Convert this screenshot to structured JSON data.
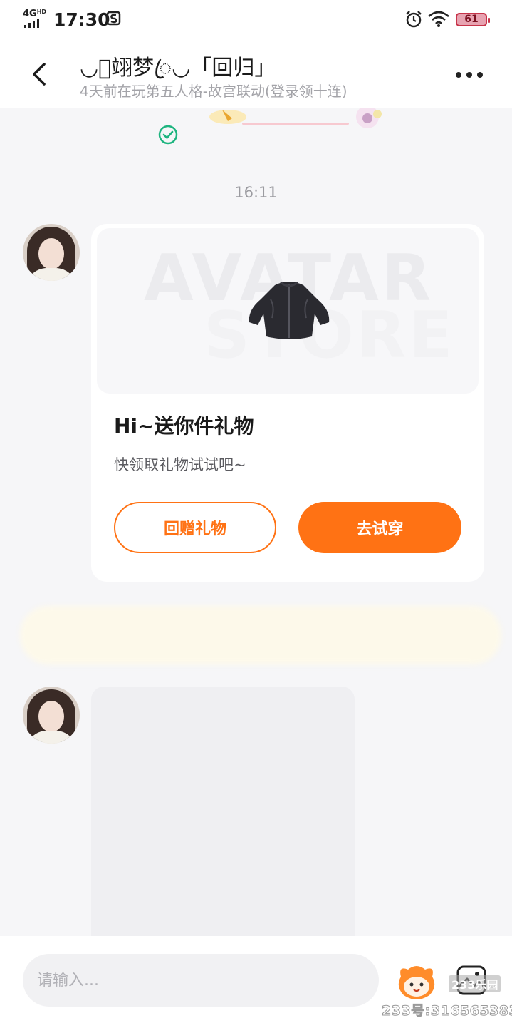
{
  "status_bar": {
    "network": "4G",
    "network_sub": "HD",
    "time": "17:30",
    "battery": "61"
  },
  "header": {
    "title": "◡ꦿ翊梦ꦿ◡「回归」",
    "subtitle": "4天前在玩第五人格-故宫联动(登录领十连)"
  },
  "chat": {
    "timestamp": "16:11",
    "gift_card": {
      "image_watermark_1": "AVATAR",
      "image_watermark_2": "STORE",
      "title": "Hi~送你件礼物",
      "description": "快领取礼物试试吧~",
      "return_gift_label": "回赠礼物",
      "try_on_label": "去试穿"
    }
  },
  "input_bar": {
    "placeholder": "请输入..."
  },
  "watermark": {
    "site_tag": "233乐园",
    "user_id": "233号:316565383"
  },
  "colors": {
    "accent": "#ff7214",
    "check": "#1db47f",
    "background": "#f6f6f8"
  }
}
